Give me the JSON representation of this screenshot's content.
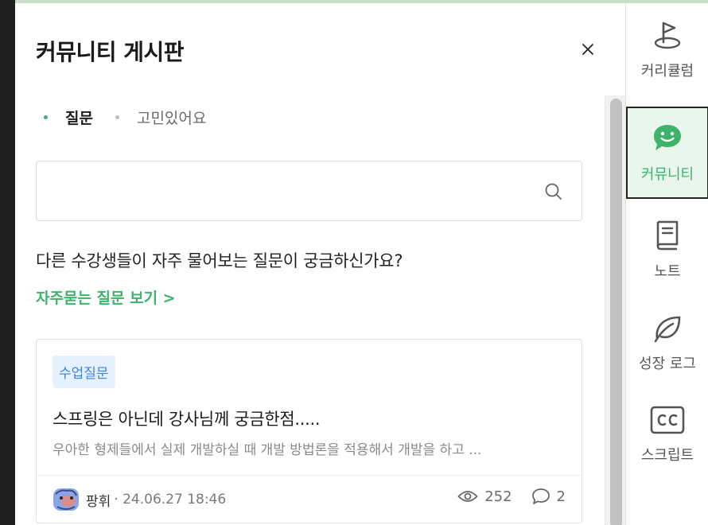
{
  "panel": {
    "title": "커뮤니티 게시판",
    "close_label": "×"
  },
  "tabs": [
    {
      "label": "질문",
      "active": true
    },
    {
      "label": "고민있어요",
      "active": false
    }
  ],
  "search": {
    "placeholder": ""
  },
  "prompt": {
    "text": "다른 수강생들이 자주 물어보는 질문이 궁금하신가요?",
    "faq_link": "자주묻는 질문 보기 >"
  },
  "post": {
    "tag": "수업질문",
    "title": "스프링은 아닌데 강사님께 궁금한점.....",
    "excerpt": "우아한 형제들에서 실제 개발하실 때 개발 방법론을 적용해서 개발을 하고 ...",
    "author": "팡휘",
    "date": "· 24.06.27 18:46",
    "views": "252",
    "comments": "2"
  },
  "sidebar": {
    "items": [
      {
        "label": "커리큘럼",
        "icon": "flag-icon"
      },
      {
        "label": "커뮤니티",
        "icon": "chat-smile-icon",
        "active": true
      },
      {
        "label": "노트",
        "icon": "book-icon"
      },
      {
        "label": "성장 로그",
        "icon": "leaf-icon"
      },
      {
        "label": "스크립트",
        "icon": "cc-icon"
      }
    ]
  },
  "colors": {
    "accent": "#3fb36b",
    "tag_bg": "#e6f1ff",
    "tag_text": "#3b82e8"
  }
}
